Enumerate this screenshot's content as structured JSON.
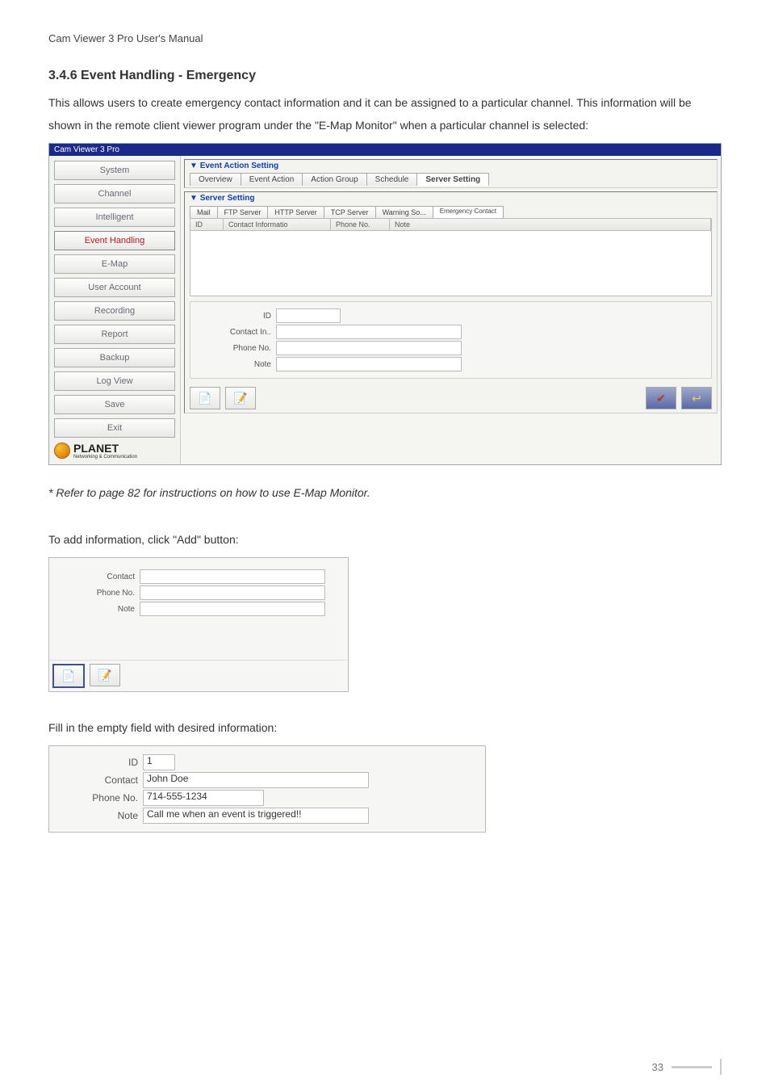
{
  "header": "Cam  Viewer  3  Pro  User's  Manual",
  "section_title": "3.4.6 Event Handling - Emergency",
  "intro_text": "This allows users to create emergency contact information and it can be assigned to a particular channel. This information will be shown in the remote client viewer program under the \"E-Map Monitor\" when a particular channel is selected:",
  "appwin": {
    "title": "Cam Viewer 3 Pro",
    "sidebar": [
      "System",
      "Channel",
      "Intelligent",
      "Event Handling",
      "E-Map",
      "User Account",
      "Recording",
      "Report",
      "Backup",
      "Log View",
      "Save",
      "Exit"
    ],
    "brand": "PLANET",
    "brand_sub": "Networking & Communication",
    "group1": {
      "title": "Event Action Setting",
      "tabs": [
        "Overview",
        "Event Action",
        "Action Group",
        "Schedule",
        "Server Setting"
      ]
    },
    "group2": {
      "title": "Server Setting",
      "subtabs": [
        "Mail",
        "FTP Server",
        "HTTP Server",
        "TCP Server",
        "Warning So...",
        "Emergency Contact"
      ],
      "columns": [
        "ID",
        "Contact Informatio",
        "Phone No.",
        "Note"
      ],
      "form": [
        "ID",
        "Contact In..",
        "Phone No.",
        "Note"
      ]
    }
  },
  "note_italic": "* Refer to page 82 for instructions on how to use E-Map Monitor.",
  "add_caption": "To add information, click \"Add\" button:",
  "addpanel": {
    "rows": [
      "Contact",
      "Phone No.",
      "Note"
    ]
  },
  "fill_caption": "Fill in the empty field with desired information:",
  "fillpanel": {
    "rows": [
      {
        "label": "ID",
        "value": "1",
        "cls": "f-id"
      },
      {
        "label": "Contact",
        "value": "John Doe",
        "cls": "f-contact"
      },
      {
        "label": "Phone No.",
        "value": "714-555-1234",
        "cls": "f-phone"
      },
      {
        "label": "Note",
        "value": "Call me when an event is triggered!!",
        "cls": "f-note"
      }
    ]
  },
  "icons": {
    "add": "📄",
    "edit": "📝",
    "ok": "✔",
    "back": "↩"
  },
  "page_number": "33"
}
